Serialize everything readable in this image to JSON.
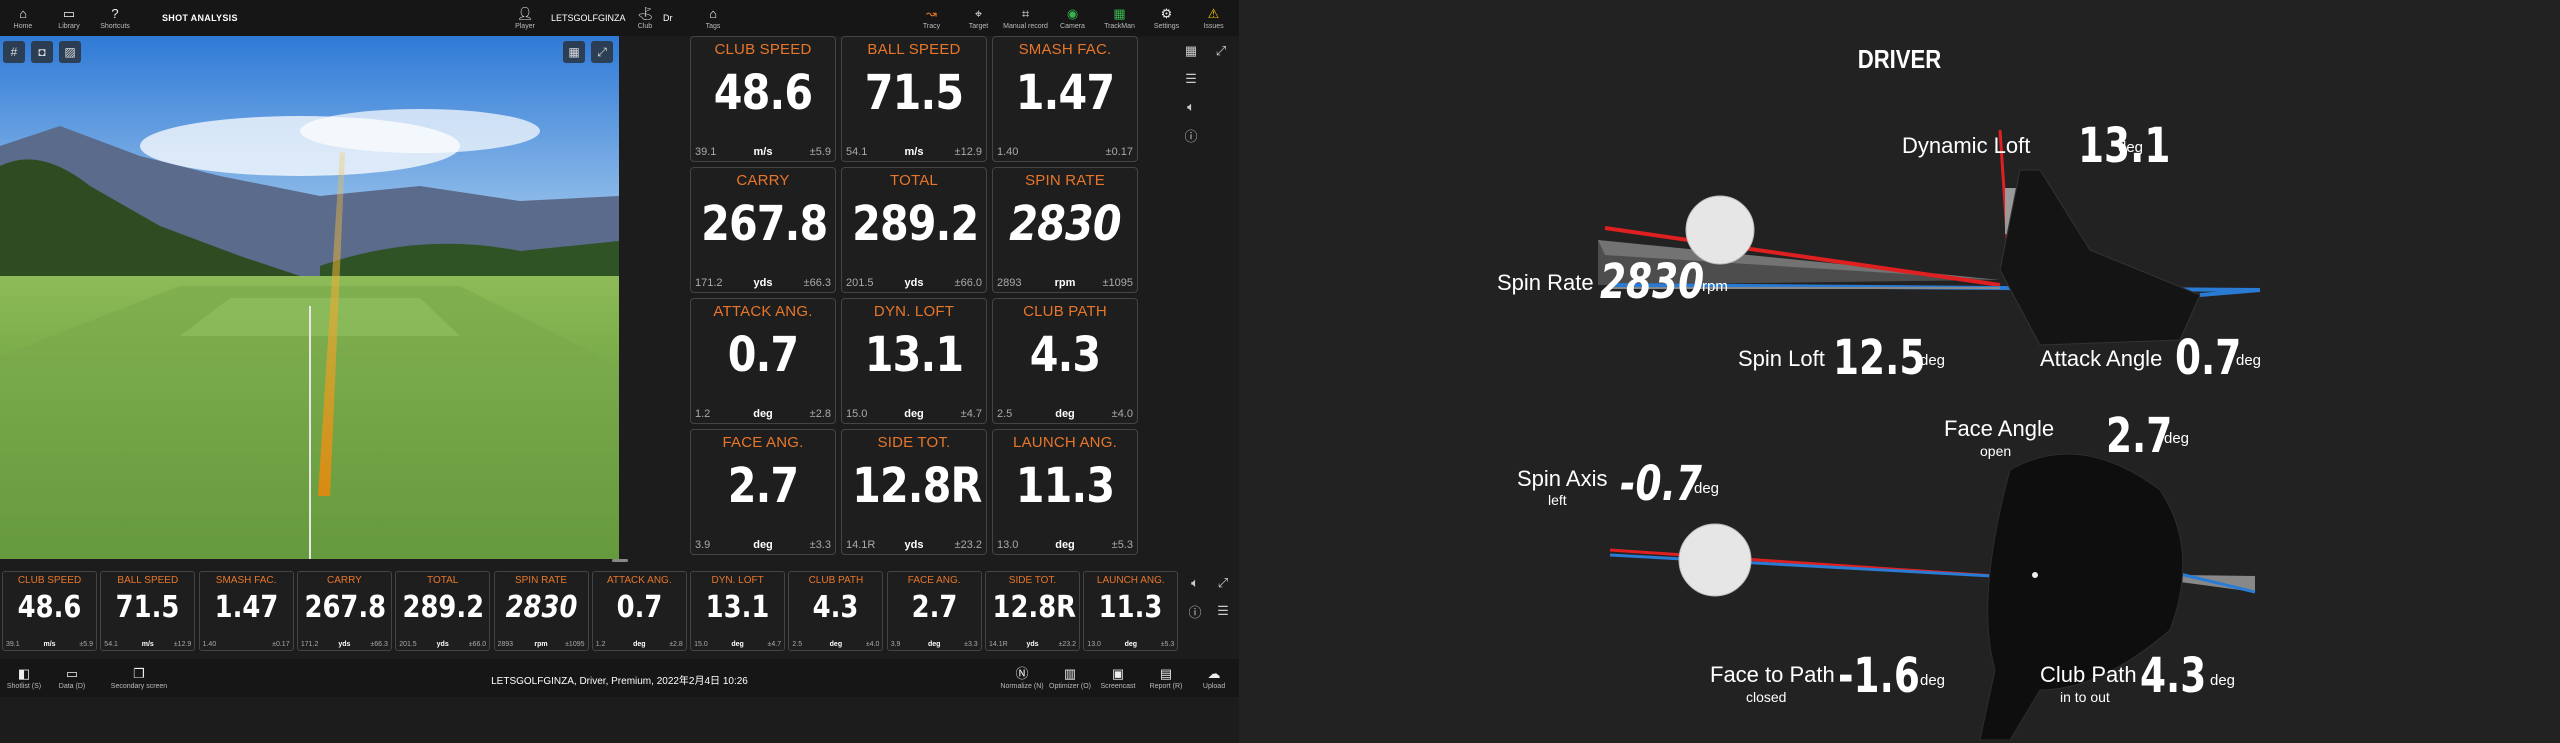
{
  "topbar": {
    "left_items": [
      {
        "icon": "⌂",
        "label": "Home"
      },
      {
        "icon": "▭",
        "label": "Library"
      },
      {
        "icon": "?",
        "label": "Shortcuts"
      }
    ],
    "title": "SHOT ANALYSIS",
    "player": {
      "name": "LETSGOLFGINZA",
      "label": "Player"
    },
    "club": {
      "value": "Dr",
      "label": "Club"
    },
    "tags": {
      "label": "Tags"
    },
    "right_items": [
      {
        "icon": "↝",
        "label": "Tracy"
      },
      {
        "icon": "⌖",
        "label": "Target"
      },
      {
        "icon": "⌗",
        "label": "Manual record"
      },
      {
        "icon": "◉",
        "label": "Camera"
      },
      {
        "icon": "▦",
        "label": "TrackMan"
      },
      {
        "icon": "⚙",
        "label": "Settings"
      },
      {
        "icon": "⚠",
        "label": "Issues"
      }
    ]
  },
  "colors": {
    "accent": "#e8762a",
    "issue": "#f2c200",
    "camera_icon": "#37b24d"
  },
  "metrics": [
    {
      "title": "CLUB SPEED",
      "value": "48.6",
      "unit": "m/s",
      "min": "39.1",
      "sd": "±5.9"
    },
    {
      "title": "BALL SPEED",
      "value": "71.5",
      "unit": "m/s",
      "min": "54.1",
      "sd": "±12.9"
    },
    {
      "title": "SMASH FAC.",
      "value": "1.47",
      "unit": "",
      "min": "1.40",
      "sd": "±0.17"
    },
    {
      "title": "CARRY",
      "value": "267.8",
      "unit": "yds",
      "min": "171.2",
      "sd": "±66.3"
    },
    {
      "title": "TOTAL",
      "value": "289.2",
      "unit": "yds",
      "min": "201.5",
      "sd": "±66.0"
    },
    {
      "title": "SPIN RATE",
      "value": "2830",
      "unit": "rpm",
      "min": "2893",
      "sd": "±1095"
    },
    {
      "title": "ATTACK ANG.",
      "value": "0.7",
      "unit": "deg",
      "min": "1.2",
      "sd": "±2.8"
    },
    {
      "title": "DYN. LOFT",
      "value": "13.1",
      "unit": "deg",
      "min": "15.0",
      "sd": "±4.7"
    },
    {
      "title": "CLUB PATH",
      "value": "4.3",
      "unit": "deg",
      "min": "2.5",
      "sd": "±4.0"
    },
    {
      "title": "FACE ANG.",
      "value": "2.7",
      "unit": "deg",
      "min": "3.9",
      "sd": "±3.3"
    },
    {
      "title": "SIDE TOT.",
      "value": "12.8R",
      "unit": "yds",
      "min": "14.1R",
      "sd": "±23.2"
    },
    {
      "title": "LAUNCH ANG.",
      "value": "11.3",
      "unit": "deg",
      "min": "13.0",
      "sd": "±5.3"
    }
  ],
  "bottombar": {
    "left_items": [
      {
        "icon": "◧",
        "label": "Shotlist (S)"
      },
      {
        "icon": "▭",
        "label": "Data (D)"
      },
      {
        "icon": "❐",
        "label": "Secondary screen"
      }
    ],
    "status": "LETSGOLFGINZA, Driver, Premium, 2022年2月4日 10:26",
    "right_items": [
      {
        "icon": "Ⓝ",
        "label": "Normalize (N)"
      },
      {
        "icon": "▥",
        "label": "Optimizer (O)"
      },
      {
        "icon": "▣",
        "label": "Screencast"
      },
      {
        "icon": "▤",
        "label": "Report (R)"
      },
      {
        "icon": "☁",
        "label": "Upload"
      }
    ]
  },
  "driver": {
    "title": "DRIVER",
    "dynamic_loft": {
      "label": "Dynamic Loft",
      "value": "13.1",
      "unit": "deg"
    },
    "spin_rate": {
      "label": "Spin Rate",
      "value": "2830",
      "unit": "rpm"
    },
    "spin_loft": {
      "label": "Spin Loft",
      "value": "12.5",
      "unit": "deg"
    },
    "attack_angle": {
      "label": "Attack Angle",
      "value": "0.7",
      "unit": "deg"
    },
    "face_angle": {
      "label": "Face Angle",
      "sub": "open",
      "value": "2.7",
      "unit": "deg"
    },
    "spin_axis": {
      "label": "Spin Axis",
      "sub": "left",
      "value": "-0.7",
      "unit": "deg"
    },
    "face_to_path": {
      "label": "Face to Path",
      "sub": "closed",
      "value": "-1.6",
      "unit": "deg"
    },
    "club_path": {
      "label": "Club Path",
      "sub": "in to out",
      "value": "4.3",
      "unit": "deg"
    }
  }
}
